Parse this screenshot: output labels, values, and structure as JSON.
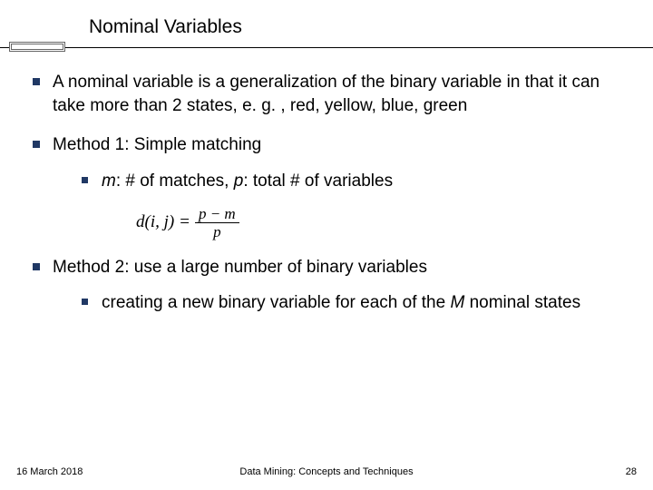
{
  "title": "Nominal Variables",
  "bullets": [
    {
      "text": "A nominal variable is a generalization of the binary variable in that it can take more than 2 states, e. g. , red, yellow, blue, green"
    },
    {
      "text": "Method 1: Simple matching",
      "sub": [
        {
          "m_var": "m",
          "m_desc": ": # of matches, ",
          "p_var": "p",
          "p_desc": ": total # of variables"
        }
      ]
    },
    {
      "text": "Method 2: use a large number of binary variables",
      "sub": [
        {
          "pre": "creating a new binary variable for each of the ",
          "M_var": "M",
          "post": " nominal states"
        }
      ]
    }
  ],
  "formula": {
    "lhs": "d(i, j)",
    "eq": "=",
    "num": "p − m",
    "den": "p"
  },
  "footer": {
    "date": "16 March 2018",
    "center": "Data Mining: Concepts and Techniques",
    "page": "28"
  },
  "colors": {
    "bullet_square": "#203864"
  }
}
